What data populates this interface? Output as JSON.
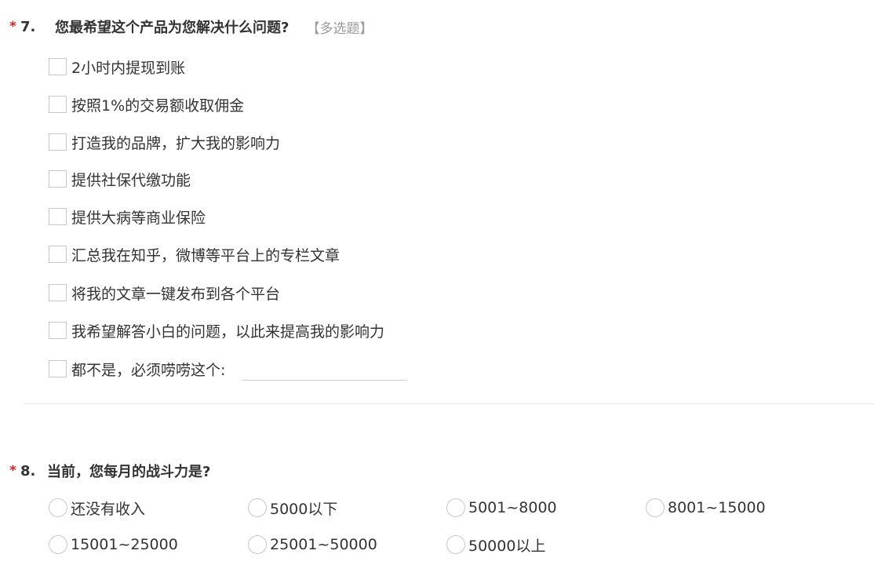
{
  "q7": {
    "required_mark": "*",
    "number": "7.",
    "title": "您最希望这个产品为您解决什么问题?",
    "type_tag": "【多选题】",
    "options": [
      "2小时内提现到账",
      "按照1%的交易额收取佣金",
      "打造我的品牌，扩大我的影响力",
      "提供社保代缴功能",
      "提供大病等商业保险",
      "汇总我在知乎，微博等平台上的专栏文章",
      "将我的文章一键发布到各个平台",
      "我希望解答小白的问题，以此来提高我的影响力",
      "都不是，必须唠唠这个:"
    ],
    "other_input_value": ""
  },
  "q8": {
    "required_mark": "*",
    "number": "8.",
    "title": "当前，您每月的战斗力是?",
    "options": [
      "还没有收入",
      "5000以下",
      "5001~8000",
      "8001~15000",
      "15001~25000",
      "25001~50000",
      "50000以上"
    ]
  }
}
